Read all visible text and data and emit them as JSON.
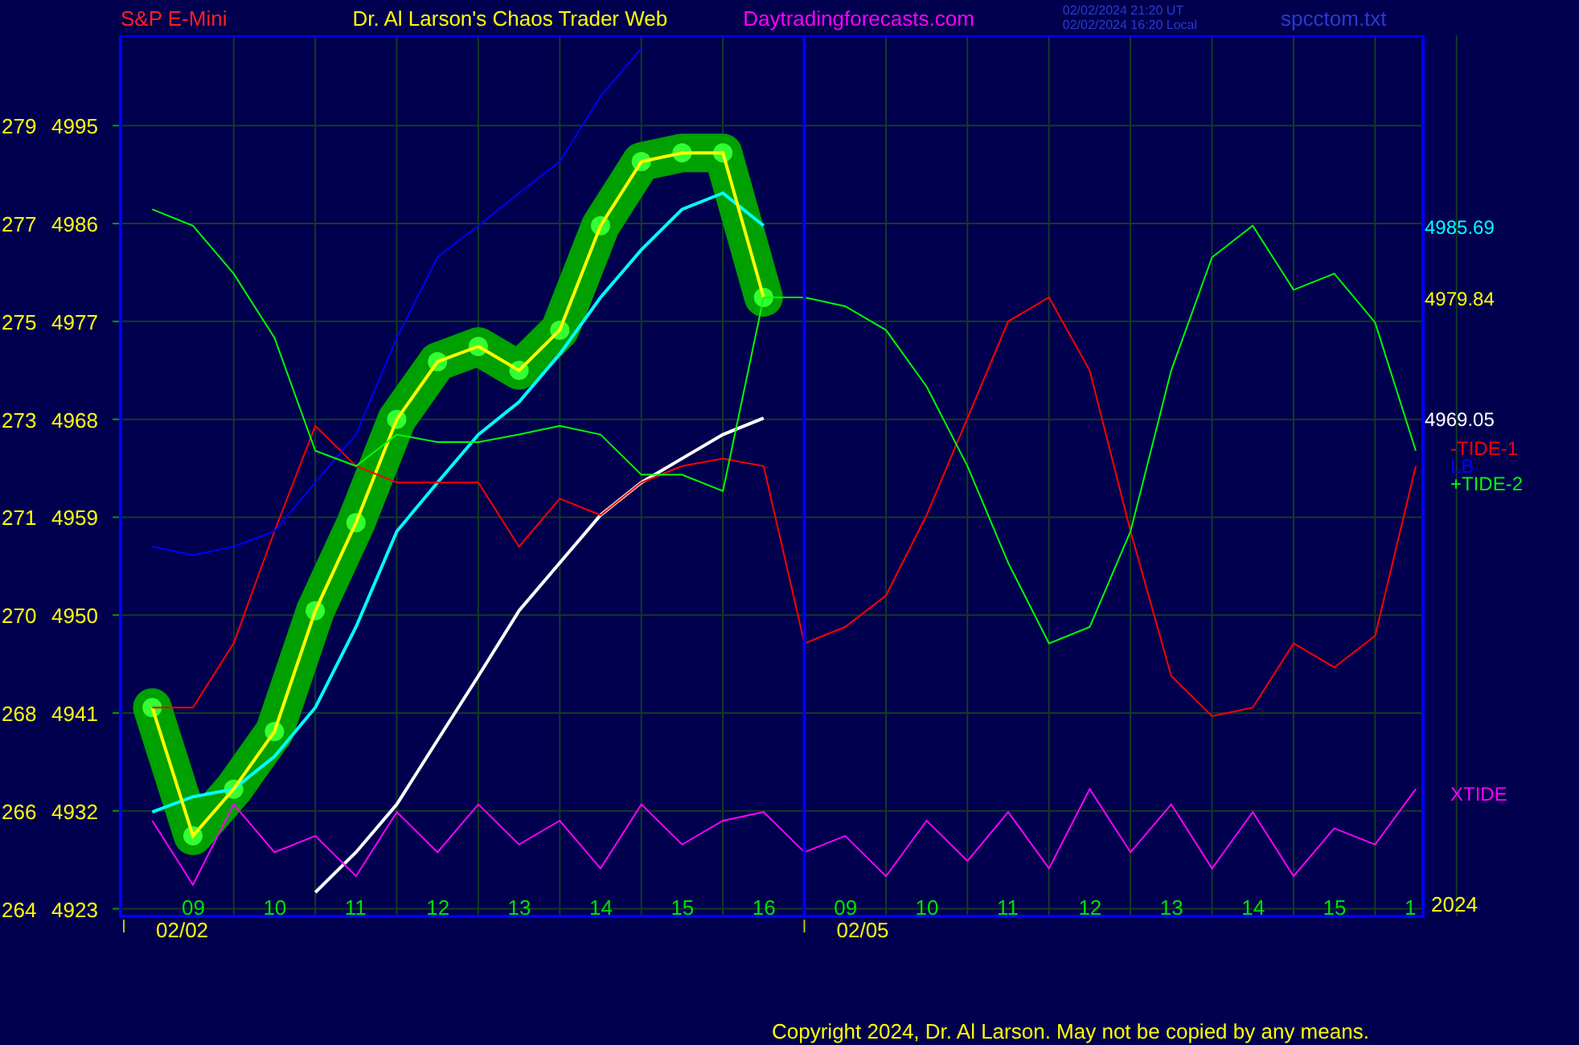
{
  "header": {
    "symbol": "S&P E-Mini",
    "title": "Dr. Al Larson's Chaos Trader Web",
    "site": "Daytradingforecasts.com",
    "timestamps": [
      "02/02/2024 21:20 UT",
      "02/02/2024 16:20 Local"
    ],
    "file": "spcctom.txt"
  },
  "chart": {
    "chart_data": {
      "type": "line",
      "grid": true,
      "ylim": [
        4922.3,
        5003.3
      ],
      "categories": [
        null,
        "09",
        null,
        "10",
        null,
        "11",
        null,
        "12",
        null,
        "13",
        null,
        "14",
        null,
        "15",
        null,
        "16",
        null,
        "09",
        null,
        "10",
        null,
        "11",
        null,
        "12",
        null,
        "13",
        null,
        "14",
        null,
        "15",
        null,
        "1"
      ],
      "yticks": [
        4995,
        4986,
        4977,
        4968,
        4959,
        4950,
        4941,
        4932,
        4923
      ],
      "series": [
        {
          "color": "#00ffff",
          "values": [
            4931.9,
            4933.3,
            4934,
            4937,
            4941.5,
            4948.9,
            4957.7,
            4962.2,
            4966.6,
            4969.6,
            4974,
            4979.2,
            4983.6,
            4987.3,
            4988.8,
            4985.8,
            null,
            null,
            null,
            null,
            null,
            null,
            null,
            null,
            null,
            null,
            null,
            null,
            null,
            null,
            null,
            null
          ]
        },
        {
          "color": "#ffff00",
          "marker": "circle",
          "values": [
            4941.5,
            4929.7,
            4934,
            4939.3,
            4950.4,
            4958.5,
            4968,
            4973.3,
            4974.7,
            4972.5,
            4976.2,
            4985.8,
            4991.7,
            4992.5,
            4992.5,
            4979.2,
            null,
            null,
            null,
            null,
            null,
            null,
            null,
            null,
            null,
            null,
            null,
            null,
            null,
            null,
            null,
            null
          ]
        },
        {
          "color": "#ffffff",
          "values": [
            null,
            null,
            null,
            null,
            4924.5,
            4928.2,
            4932.6,
            4938.5,
            4944.4,
            4950.4,
            4954.8,
            4959.2,
            4962.2,
            4964.4,
            4966.6,
            4968.1,
            null,
            null,
            null,
            null,
            null,
            null,
            null,
            null,
            null,
            null,
            null,
            null,
            null,
            null,
            null,
            null
          ]
        },
        {
          "name": "-TIDE-1",
          "color": "#ff0000",
          "values": [
            4941.5,
            4941.5,
            4947.4,
            4957.7,
            4967.4,
            4963.7,
            4962.2,
            4962.2,
            4962.2,
            4956.3,
            4960.7,
            4959.2,
            4962.2,
            4963.7,
            4964.4,
            4963.7,
            4947.4,
            4948.9,
            4951.8,
            4959.2,
            4968.1,
            4977,
            4979.2,
            4972.5,
            4957.7,
            4944.4,
            4940.7,
            4941.5,
            4947.4,
            4945.2,
            4948.1,
            4963.7
          ]
        },
        {
          "name": "LB",
          "color": "#0000ff",
          "values": [
            4956.3,
            4955.5,
            4956.3,
            4957.7,
            4962.2,
            4966.6,
            4975.5,
            4982.9,
            4985.8,
            4988.8,
            4991.7,
            4997.7,
            5002.1,
            null,
            null,
            null,
            null,
            null,
            null,
            null,
            null,
            null,
            null,
            null,
            null,
            null,
            null,
            null,
            null,
            null,
            null,
            null
          ]
        },
        {
          "name": "+TIDE-2",
          "color": "#00ff00",
          "values": [
            4987.3,
            4985.8,
            4981.4,
            4975.5,
            4965.1,
            4963.7,
            4966.6,
            4965.9,
            4965.9,
            4966.6,
            4967.4,
            4966.6,
            4962.9,
            4962.9,
            4961.4,
            4979.2,
            4979.2,
            4978.4,
            4976.2,
            4971,
            4963.7,
            4954.8,
            4947.4,
            4948.9,
            4957.7,
            4972.5,
            4982.9,
            4985.8,
            4979.9,
            4981.4,
            4976.9,
            4965.1
          ]
        },
        {
          "name": "XTIDE",
          "color": "#ff00ff",
          "values": [
            4931.1,
            4925.2,
            4932.6,
            4928.2,
            4929.7,
            4926,
            4931.9,
            4928.2,
            4932.6,
            4928.9,
            4931.1,
            4926.7,
            4932.6,
            4928.9,
            4931.1,
            4931.9,
            4928.2,
            4929.7,
            4926,
            4931.1,
            4927.4,
            4931.9,
            4926.7,
            4934,
            4928.2,
            4932.6,
            4926.7,
            4931.9,
            4926,
            4930.4,
            4928.9,
            4934
          ]
        }
      ]
    },
    "end_values": [
      {
        "text": "4985.69",
        "color": "#00ffff"
      },
      {
        "text": "4979.84",
        "color": "#ffff00"
      },
      {
        "text": "4969.05",
        "color": "#ffffff"
      }
    ],
    "left_labels": [
      "279",
      "277",
      "275",
      "273",
      "271",
      "270",
      "268",
      "266",
      "264"
    ],
    "date_labels": [
      "02/02",
      "02/05"
    ],
    "year": "2024"
  },
  "copyright": "Copyright 2024, Dr. Al Larson. May not be copied by any means."
}
